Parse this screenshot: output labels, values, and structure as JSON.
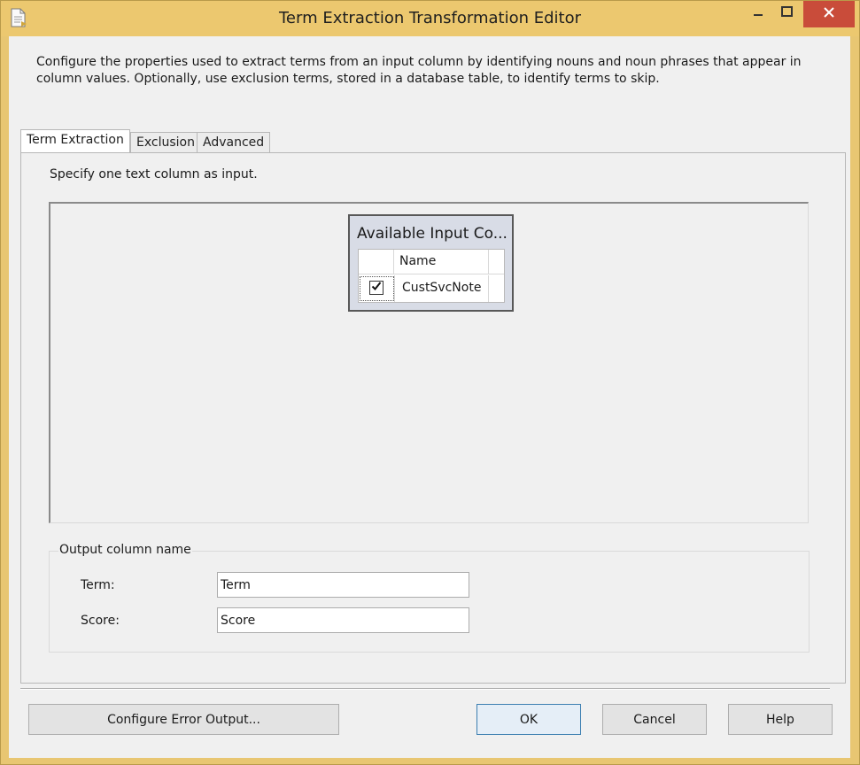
{
  "window": {
    "title": "Term Extraction Transformation Editor"
  },
  "description": "Configure the properties used to extract terms from an input column by identifying nouns and noun phrases that appear in column values. Optionally, use exclusion terms, stored in a database table, to identify terms to skip.",
  "tabs": [
    {
      "label": "Term Extraction",
      "active": true
    },
    {
      "label": "Exclusion",
      "active": false
    },
    {
      "label": "Advanced",
      "active": false
    }
  ],
  "term_extraction": {
    "instruction": "Specify one text column as input.",
    "available_input": {
      "title": "Available Input Co...",
      "header_name": "Name",
      "rows": [
        {
          "checked": true,
          "name": "CustSvcNote"
        }
      ]
    },
    "output_group": {
      "legend": "Output column name",
      "term_label": "Term:",
      "term_value": "Term",
      "score_label": "Score:",
      "score_value": "Score"
    }
  },
  "buttons": {
    "configure_error_output": "Configure Error Output...",
    "ok": "OK",
    "cancel": "Cancel",
    "help": "Help"
  },
  "icons": {
    "app": "document-icon",
    "minimize": "minimize-icon",
    "maximize": "maximize-icon",
    "close": "close-icon",
    "check": "checkmark-icon"
  },
  "colors": {
    "title_bar": "#ecc86f",
    "close_button": "#c94c3a",
    "default_button_border": "#3c7fb1"
  }
}
